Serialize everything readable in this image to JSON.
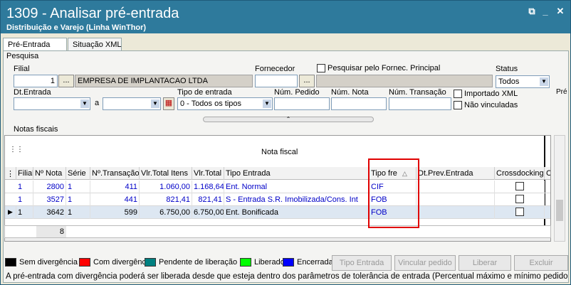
{
  "window": {
    "title": "1309 - Analisar pré-entrada",
    "subtitle": "Distribuição e Varejo (Linha WinThor)"
  },
  "tabs": [
    "Pré-Entrada",
    "Situação XML"
  ],
  "filters": {
    "section_label": "Pesquisa",
    "filial_label": "Filial",
    "filial_value": "1",
    "company_name": "EMPRESA DE IMPLANTACAO LTDA",
    "fornecedor_label": "Fornecedor",
    "pesquisar_label": "Pesquisar pelo Fornec. Principal",
    "status_label": "Status",
    "status_value": "Todos",
    "dt_entrada_label": "Dt.Entrada",
    "a_label": "a",
    "tipo_entrada_label": "Tipo de entrada",
    "tipo_entrada_value": "0 - Todos os tipos",
    "num_pedido_label": "Núm. Pedido",
    "num_nota_label": "Núm. Nota",
    "num_transacao_label": "Núm. Transação",
    "importado_xml_label": "Importado XML",
    "nao_vinculadas_label": "Não vinculadas",
    "side_tab_label": "Pré",
    "ellipsis": "..."
  },
  "grid": {
    "section_label": "Notas fiscais",
    "group_header": "Nota fiscal",
    "columns": [
      "Filial",
      "Nº Nota",
      "Série",
      "Nº.Transação",
      "Vlr.Total Itens",
      "Vlr.Total",
      "Tipo Entrada",
      "Tipo fre",
      "Dt.Prev.Entrada",
      "Crossdocking",
      "Co"
    ],
    "rows": [
      {
        "filial": "1",
        "nota": "2800",
        "serie": "1",
        "transacao": "411",
        "vlr_itens": "1.060,00",
        "vlr_total": "1.168,64",
        "tipo_entrada": "Ent. Normal",
        "tipo_frete": "CIF"
      },
      {
        "filial": "1",
        "nota": "3527",
        "serie": "1",
        "transacao": "441",
        "vlr_itens": "821,41",
        "vlr_total": "821,41",
        "tipo_entrada": "S - Entrada S.R. Imobilizada/Cons. Int",
        "tipo_frete": "FOB"
      },
      {
        "filial": "1",
        "nota": "3642",
        "serie": "1",
        "transacao": "599",
        "vlr_itens": "6.750,00",
        "vlr_total": "6.750,00",
        "tipo_entrada": "Ent. Bonificada",
        "tipo_frete": "FOB"
      }
    ],
    "footer_count": "8"
  },
  "legend": [
    {
      "label": "Sem divergência",
      "color": "#000000"
    },
    {
      "label": "Com divergência",
      "color": "#ff0000"
    },
    {
      "label": "Pendente de liberação",
      "color": "#008080"
    },
    {
      "label": "Liberado",
      "color": "#00ff00"
    },
    {
      "label": "Encerrada",
      "color": "#0000ff"
    }
  ],
  "actions": {
    "tipo_entrada": "Tipo Entrada",
    "vincular_pedido": "Vincular pedido",
    "liberar": "Liberar",
    "excluir": "Excluir"
  },
  "message": "A pré-entrada com divergência poderá ser liberada desde que esteja dentro dos parâmetros de tolerância de entrada (Percentual máximo e mínimo pedido x"
}
